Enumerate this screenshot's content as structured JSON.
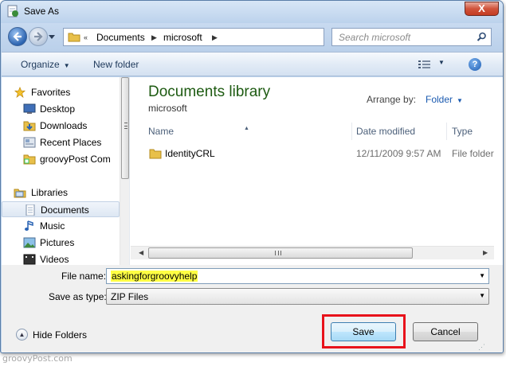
{
  "window": {
    "title": "Save As",
    "close_label": "X"
  },
  "nav": {
    "breadcrumb_prefix": "«",
    "breadcrumb": [
      "Documents",
      "microsoft"
    ],
    "breadcrumb_sep": "▶",
    "search_placeholder": "Search microsoft"
  },
  "toolbar": {
    "organize": "Organize",
    "new_folder": "New folder",
    "help": "?"
  },
  "sidebar": {
    "favorites": {
      "label": "Favorites",
      "items": [
        "Desktop",
        "Downloads",
        "Recent Places",
        "groovyPost Com"
      ]
    },
    "libraries": {
      "label": "Libraries",
      "items": [
        "Documents",
        "Music",
        "Pictures",
        "Videos"
      ]
    }
  },
  "main": {
    "library_title": "Documents library",
    "library_subtitle": "microsoft",
    "arrange_label": "Arrange by:",
    "arrange_value": "Folder",
    "columns": [
      "Name",
      "Date modified",
      "Type"
    ],
    "rows": [
      {
        "name": "IdentityCRL",
        "date": "12/11/2009 9:57 AM",
        "type": "File folder"
      }
    ]
  },
  "form": {
    "file_name_label": "File name:",
    "file_name_value": "askingforgroovyhelp",
    "save_type_label": "Save as type:",
    "save_type_value": "ZIP Files",
    "hide_folders": "Hide Folders",
    "save_button": "Save",
    "cancel_button": "Cancel"
  },
  "watermark": "groovyPost.com",
  "colors": {
    "highlight": "#ffff44",
    "annotation_box": "#e8121b",
    "library_title": "#1e5b12"
  }
}
